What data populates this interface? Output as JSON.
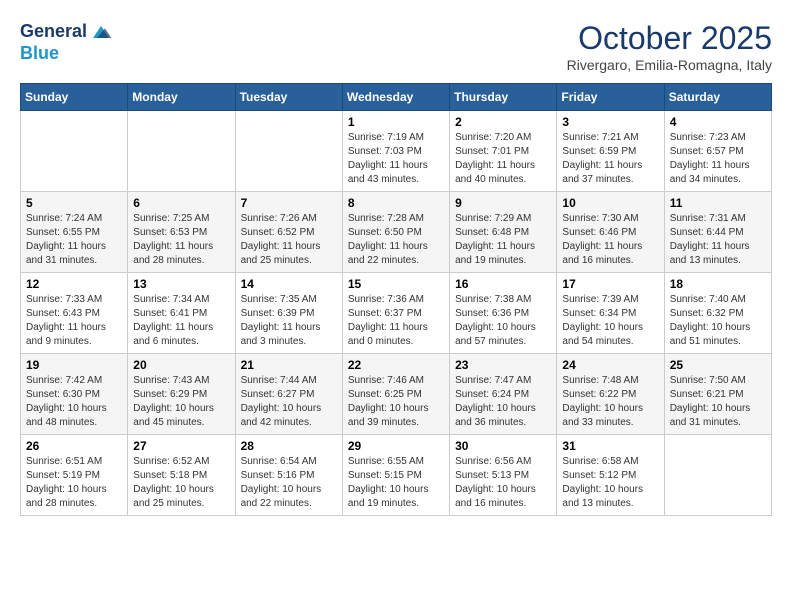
{
  "header": {
    "logo_line1": "General",
    "logo_line2": "Blue",
    "month": "October 2025",
    "location": "Rivergaro, Emilia-Romagna, Italy"
  },
  "weekdays": [
    "Sunday",
    "Monday",
    "Tuesday",
    "Wednesday",
    "Thursday",
    "Friday",
    "Saturday"
  ],
  "weeks": [
    [
      {
        "day": "",
        "info": ""
      },
      {
        "day": "",
        "info": ""
      },
      {
        "day": "",
        "info": ""
      },
      {
        "day": "1",
        "info": "Sunrise: 7:19 AM\nSunset: 7:03 PM\nDaylight: 11 hours and 43 minutes."
      },
      {
        "day": "2",
        "info": "Sunrise: 7:20 AM\nSunset: 7:01 PM\nDaylight: 11 hours and 40 minutes."
      },
      {
        "day": "3",
        "info": "Sunrise: 7:21 AM\nSunset: 6:59 PM\nDaylight: 11 hours and 37 minutes."
      },
      {
        "day": "4",
        "info": "Sunrise: 7:23 AM\nSunset: 6:57 PM\nDaylight: 11 hours and 34 minutes."
      }
    ],
    [
      {
        "day": "5",
        "info": "Sunrise: 7:24 AM\nSunset: 6:55 PM\nDaylight: 11 hours and 31 minutes."
      },
      {
        "day": "6",
        "info": "Sunrise: 7:25 AM\nSunset: 6:53 PM\nDaylight: 11 hours and 28 minutes."
      },
      {
        "day": "7",
        "info": "Sunrise: 7:26 AM\nSunset: 6:52 PM\nDaylight: 11 hours and 25 minutes."
      },
      {
        "day": "8",
        "info": "Sunrise: 7:28 AM\nSunset: 6:50 PM\nDaylight: 11 hours and 22 minutes."
      },
      {
        "day": "9",
        "info": "Sunrise: 7:29 AM\nSunset: 6:48 PM\nDaylight: 11 hours and 19 minutes."
      },
      {
        "day": "10",
        "info": "Sunrise: 7:30 AM\nSunset: 6:46 PM\nDaylight: 11 hours and 16 minutes."
      },
      {
        "day": "11",
        "info": "Sunrise: 7:31 AM\nSunset: 6:44 PM\nDaylight: 11 hours and 13 minutes."
      }
    ],
    [
      {
        "day": "12",
        "info": "Sunrise: 7:33 AM\nSunset: 6:43 PM\nDaylight: 11 hours and 9 minutes."
      },
      {
        "day": "13",
        "info": "Sunrise: 7:34 AM\nSunset: 6:41 PM\nDaylight: 11 hours and 6 minutes."
      },
      {
        "day": "14",
        "info": "Sunrise: 7:35 AM\nSunset: 6:39 PM\nDaylight: 11 hours and 3 minutes."
      },
      {
        "day": "15",
        "info": "Sunrise: 7:36 AM\nSunset: 6:37 PM\nDaylight: 11 hours and 0 minutes."
      },
      {
        "day": "16",
        "info": "Sunrise: 7:38 AM\nSunset: 6:36 PM\nDaylight: 10 hours and 57 minutes."
      },
      {
        "day": "17",
        "info": "Sunrise: 7:39 AM\nSunset: 6:34 PM\nDaylight: 10 hours and 54 minutes."
      },
      {
        "day": "18",
        "info": "Sunrise: 7:40 AM\nSunset: 6:32 PM\nDaylight: 10 hours and 51 minutes."
      }
    ],
    [
      {
        "day": "19",
        "info": "Sunrise: 7:42 AM\nSunset: 6:30 PM\nDaylight: 10 hours and 48 minutes."
      },
      {
        "day": "20",
        "info": "Sunrise: 7:43 AM\nSunset: 6:29 PM\nDaylight: 10 hours and 45 minutes."
      },
      {
        "day": "21",
        "info": "Sunrise: 7:44 AM\nSunset: 6:27 PM\nDaylight: 10 hours and 42 minutes."
      },
      {
        "day": "22",
        "info": "Sunrise: 7:46 AM\nSunset: 6:25 PM\nDaylight: 10 hours and 39 minutes."
      },
      {
        "day": "23",
        "info": "Sunrise: 7:47 AM\nSunset: 6:24 PM\nDaylight: 10 hours and 36 minutes."
      },
      {
        "day": "24",
        "info": "Sunrise: 7:48 AM\nSunset: 6:22 PM\nDaylight: 10 hours and 33 minutes."
      },
      {
        "day": "25",
        "info": "Sunrise: 7:50 AM\nSunset: 6:21 PM\nDaylight: 10 hours and 31 minutes."
      }
    ],
    [
      {
        "day": "26",
        "info": "Sunrise: 6:51 AM\nSunset: 5:19 PM\nDaylight: 10 hours and 28 minutes."
      },
      {
        "day": "27",
        "info": "Sunrise: 6:52 AM\nSunset: 5:18 PM\nDaylight: 10 hours and 25 minutes."
      },
      {
        "day": "28",
        "info": "Sunrise: 6:54 AM\nSunset: 5:16 PM\nDaylight: 10 hours and 22 minutes."
      },
      {
        "day": "29",
        "info": "Sunrise: 6:55 AM\nSunset: 5:15 PM\nDaylight: 10 hours and 19 minutes."
      },
      {
        "day": "30",
        "info": "Sunrise: 6:56 AM\nSunset: 5:13 PM\nDaylight: 10 hours and 16 minutes."
      },
      {
        "day": "31",
        "info": "Sunrise: 6:58 AM\nSunset: 5:12 PM\nDaylight: 10 hours and 13 minutes."
      },
      {
        "day": "",
        "info": ""
      }
    ]
  ]
}
